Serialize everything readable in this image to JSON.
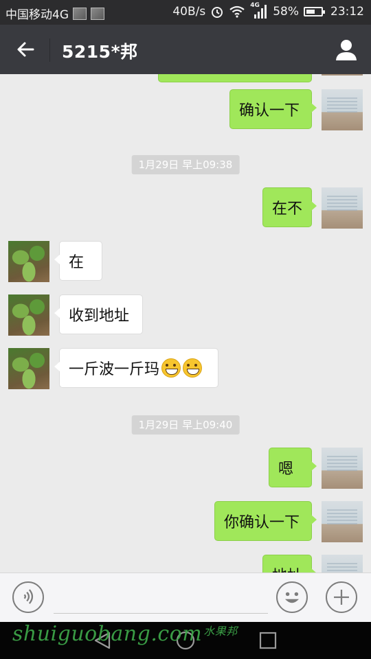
{
  "status_bar": {
    "carrier": "中国移动4G",
    "speed": "40B/s",
    "network_badge": "4G",
    "battery": "58%",
    "battery_level": 0.58,
    "time": "23:12",
    "icons": [
      "image-thumb-icon",
      "image-thumb-icon",
      "alarm-icon",
      "wifi-icon",
      "signal-icon",
      "battery-icon"
    ]
  },
  "header": {
    "title": "5215*邦",
    "back_icon": "back-arrow-icon",
    "profile_icon": "person-icon"
  },
  "messages": [
    {
      "type": "msg",
      "side": "out",
      "text": "确认一下"
    },
    {
      "type": "time",
      "text": "1月29日 早上09:38"
    },
    {
      "type": "msg",
      "side": "out",
      "text": "在不"
    },
    {
      "type": "msg",
      "side": "in",
      "text": "在"
    },
    {
      "type": "msg",
      "side": "in",
      "text": "收到地址"
    },
    {
      "type": "msg",
      "side": "in",
      "text": "一斤波一斤玛",
      "emoji_count": 2
    },
    {
      "type": "time",
      "text": "1月29日 早上09:40"
    },
    {
      "type": "msg",
      "side": "out",
      "text": "嗯"
    },
    {
      "type": "msg",
      "side": "out",
      "text": "你确认一下"
    },
    {
      "type": "msg",
      "side": "out",
      "text": "地址"
    }
  ],
  "input_bar": {
    "voice_icon": "voice-icon",
    "emoji_icon": "emoji-icon",
    "plus_icon": "plus-icon"
  },
  "nav_bar": {
    "icons": [
      "nav-back-icon",
      "nav-home-icon",
      "nav-recents-icon"
    ]
  },
  "watermark": {
    "text": "shuiguobang",
    "suffix": ".com",
    "chinese": "水果邦"
  },
  "colors": {
    "title_bar": "#393a3f",
    "outgoing_bubble": "#a0e75a",
    "incoming_bubble": "#ffffff",
    "chat_bg": "#ebebeb"
  }
}
